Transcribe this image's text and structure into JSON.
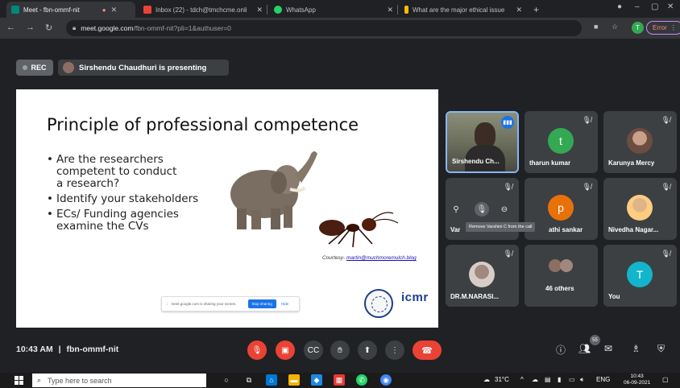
{
  "browser": {
    "tabs": [
      {
        "title": "Meet - fbn-ommf-nit",
        "fav_color": "#00897b",
        "active": true
      },
      {
        "title": "Inbox (22) - tdch@tmchcme.onli",
        "fav_color": "#ea4335",
        "active": false
      },
      {
        "title": "WhatsApp",
        "fav_color": "#25d366",
        "active": false
      },
      {
        "title": "What are the major ethical issue",
        "fav_color": "#fbbc04",
        "active": false
      }
    ],
    "new_tab": "+",
    "url_host": "meet.google.com",
    "url_path": "/fbn-ommf-nit?pli=1&authuser=0",
    "profile_initial": "T",
    "error_label": "Error"
  },
  "meet": {
    "rec_label": "REC",
    "presenting_text": "Sirshendu Chaudhuri is presenting"
  },
  "slide": {
    "title": "Principle of professional competence",
    "bullets": [
      "Are the researchers competent to conduct a research?",
      "Identify your stakeholders",
      "ECs/ Funding agencies examine the CVs"
    ],
    "courtesy_prefix": "Courtesy-",
    "courtesy_link": "martin@muchmoremulch.blog",
    "share_text": "meet.google.com is sharing your screen.",
    "stop_sharing": "Stop sharing",
    "hide": "Hide",
    "logo_text": "icmr"
  },
  "participants": [
    {
      "name": "Sirshendu Ch...",
      "type": "video"
    },
    {
      "name": "tharun kumar",
      "initial": "t",
      "color": "#34a853"
    },
    {
      "name": "Karunya Mercy",
      "type": "photo"
    },
    {
      "name": "Var",
      "type": "hover"
    },
    {
      "name": "athi sankar",
      "initial": "p",
      "color": "#e8710a"
    },
    {
      "name": "Nivedha Nagar...",
      "type": "photo"
    },
    {
      "name": "DR.M.NARASI...",
      "type": "photo"
    },
    {
      "name": "46 others",
      "type": "group"
    },
    {
      "name": "You",
      "initial": "T",
      "color": "#12b5cb"
    }
  ],
  "tooltip": "Remove Varshini C from the call",
  "bottom": {
    "time": "10:43 AM",
    "separator": "|",
    "meeting_code": "fbn-ommf-nit",
    "people_count": "55"
  },
  "taskbar": {
    "search_placeholder": "Type here to search",
    "temperature": "31°C",
    "language": "ENG",
    "clock_time": "10:43",
    "clock_date": "06-09-2021"
  }
}
